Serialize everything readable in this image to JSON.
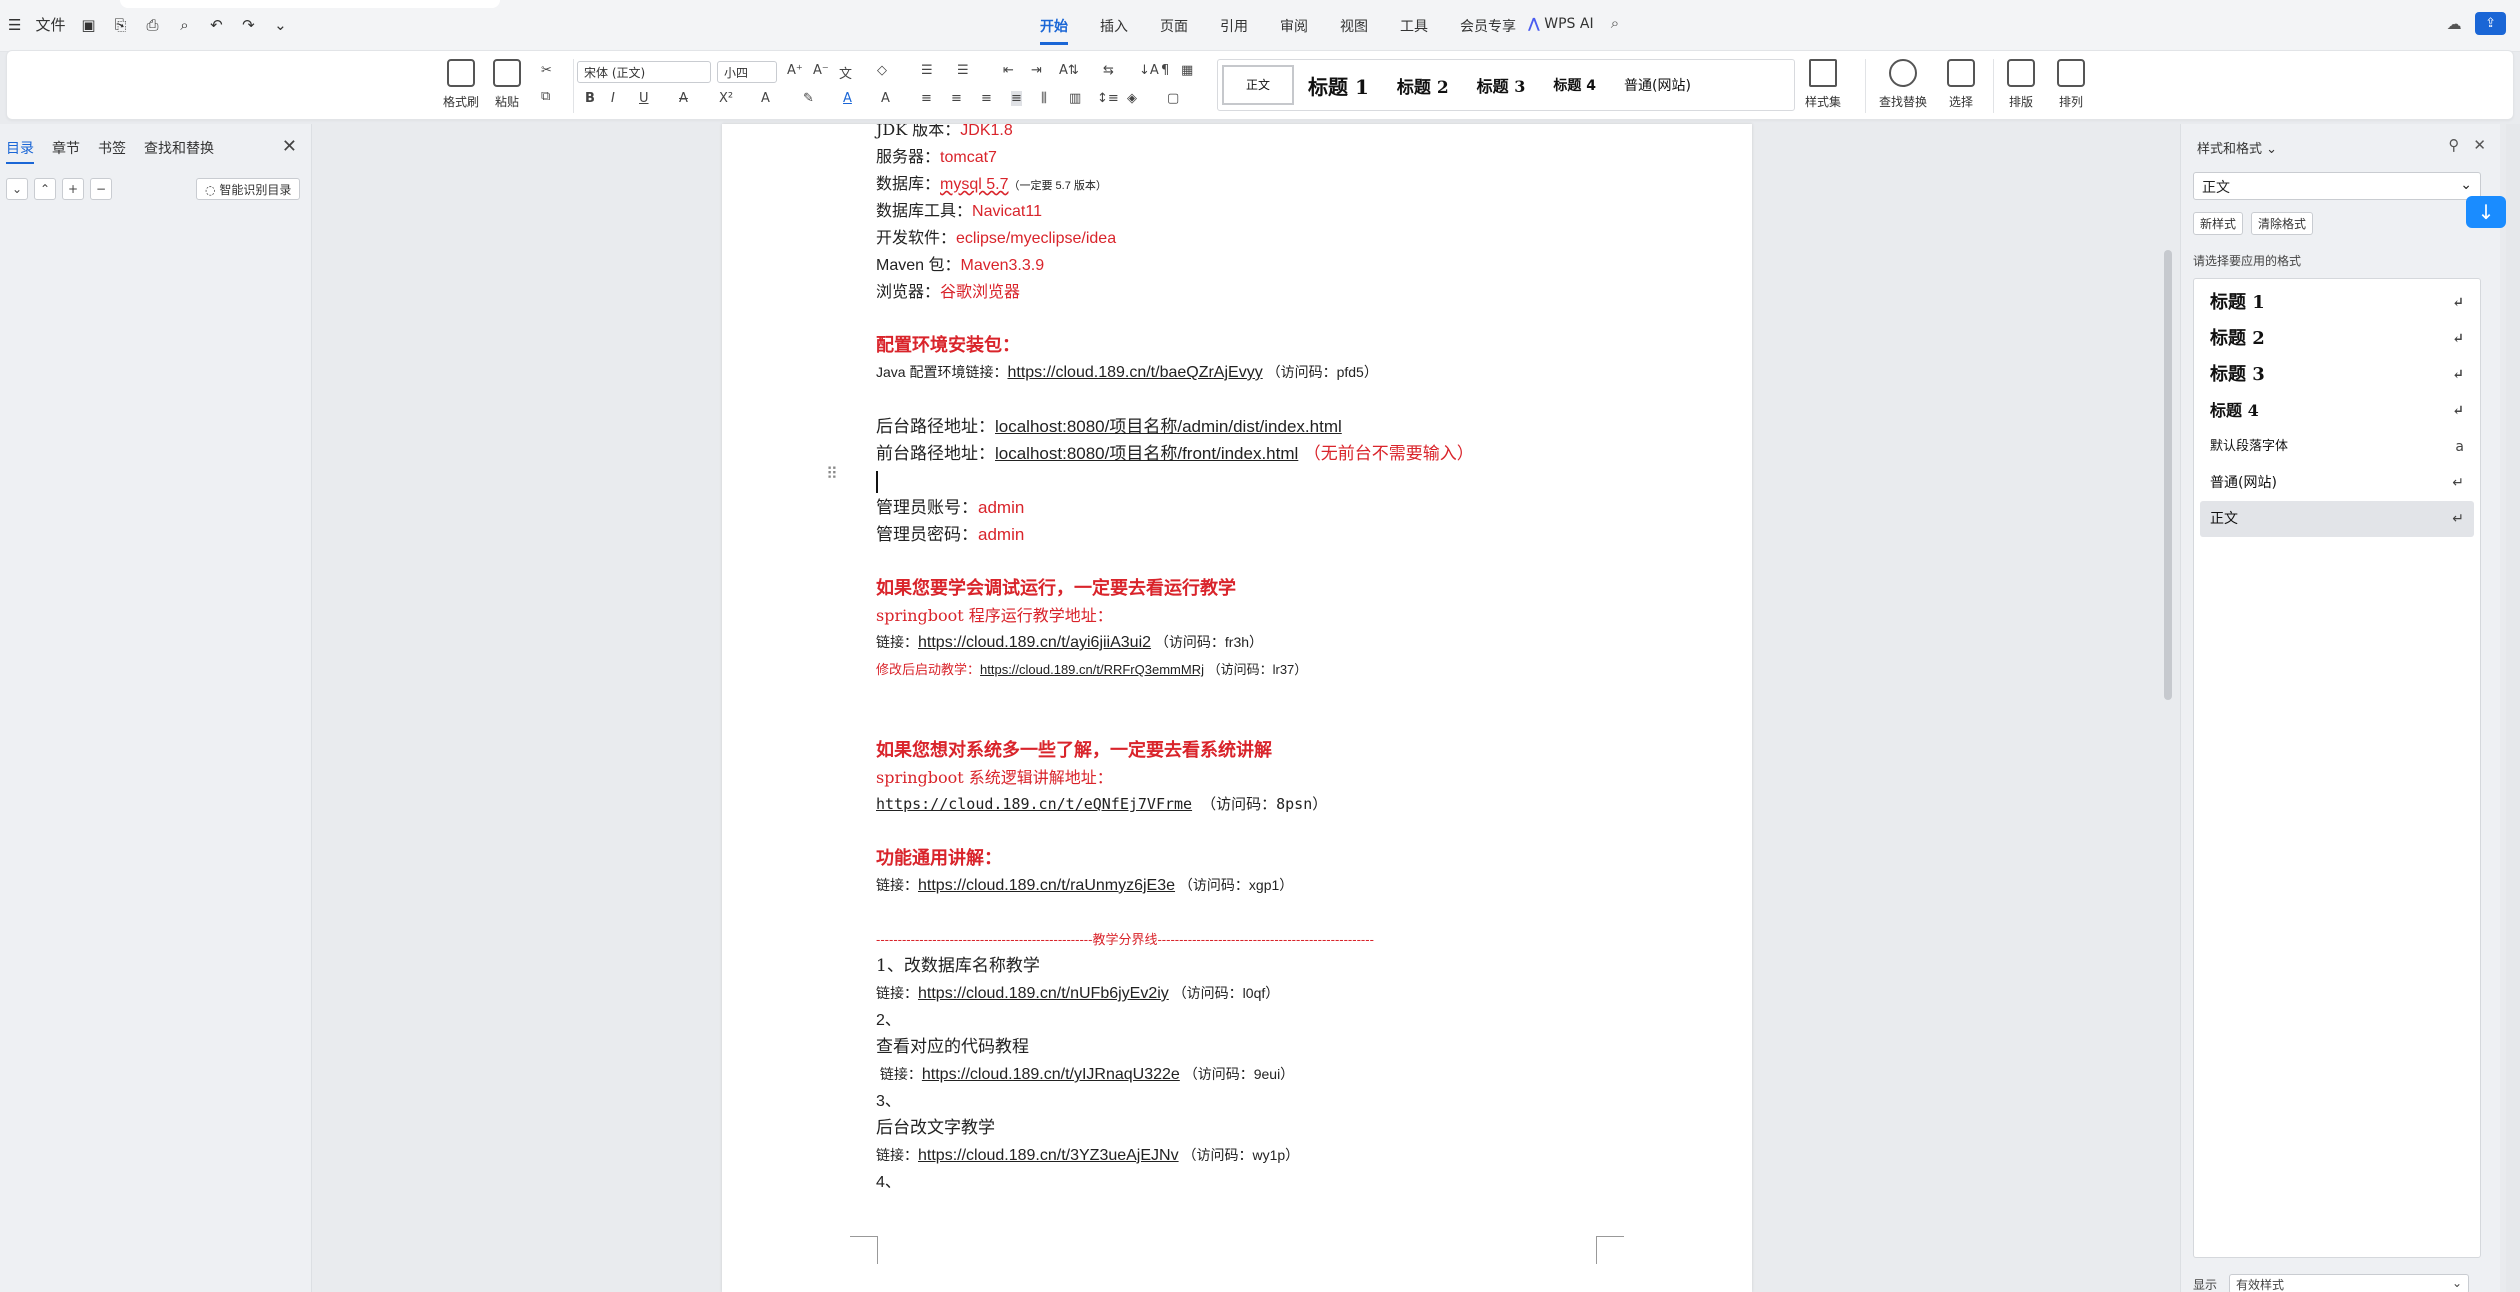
{
  "menubar": {
    "file": "文件",
    "tabs": [
      "开始",
      "插入",
      "页面",
      "引用",
      "审阅",
      "视图",
      "工具",
      "会员专享"
    ],
    "wps_ai": "WPS AI"
  },
  "ribbon": {
    "format_painter": "格式刷",
    "paste": "粘贴",
    "font_name": "宋体 (正文)",
    "font_size": "小四",
    "styles": [
      "正文",
      "标题 1",
      "标题 2",
      "标题 3",
      "标题 4",
      "普通(网站)"
    ],
    "style_set": "样式集",
    "find_replace": "查找替换",
    "select": "选择",
    "layout": "排版",
    "arrange": "排列"
  },
  "left_pane": {
    "tabs": [
      "目录",
      "章节",
      "书签",
      "查找和替换"
    ],
    "smart_toc": "智能识别目录"
  },
  "doc": {
    "jdk_label": "JDK 版本：",
    "jdk_value": "JDK1.8",
    "server_label": "服务器：",
    "server_value": "tomcat7",
    "db_label": "数据库：",
    "db_value": "mysql 5.7",
    "db_note": "（一定要 5.7 版本）",
    "dbtool_label": "数据库工具：",
    "dbtool_value": "Navicat11",
    "ide_label": "开发软件：",
    "ide_value": "eclipse/myeclipse/idea",
    "maven_label": "Maven 包：",
    "maven_value": "Maven3.3.9",
    "browser_label": "浏览器：",
    "browser_value": "谷歌浏览器",
    "env_heading": "配置环境安装包：",
    "java_env": "Java 配置环境链接：",
    "java_env_link": "https://cloud.189.cn/t/baeQZrAjEvyy",
    "java_env_code": "（访问码：pfd5）",
    "backend_label": "后台路径地址：",
    "backend_value": "localhost:8080/项目名称/admin/dist/index.html",
    "frontend_label": "前台路径地址：",
    "frontend_value": "localhost:8080/项目名称/front/index.html",
    "frontend_note": "（无前台不需要输入）",
    "admin_user_label": "管理员账号：",
    "admin_user": "admin",
    "admin_pwd_label": "管理员密码：",
    "admin_pwd": "admin",
    "run_heading": "如果您要学会调试运行，一定要去看运行教学",
    "run_sub": "springboot 程序运行教学地址：",
    "run_link_label": "链接：",
    "run_link": "https://cloud.189.cn/t/ayi6jiiA3ui2",
    "run_code": "（访问码：fr3h）",
    "modify_label": "修改后启动教学：",
    "modify_link": "https://cloud.189.cn/t/RRFrQ3emmMRj",
    "modify_code": "（访问码：lr37）",
    "sys_heading": "如果您想对系统多一些了解，一定要去看系统讲解",
    "sys_sub": "springboot 系统逻辑讲解地址：",
    "sys_link": "https://cloud.189.cn/t/eQNfEj7VFrme",
    "sys_code": "（访问码：8psn）",
    "func_heading": "功能通用讲解：",
    "func_link_label": "链接：",
    "func_link": "https://cloud.189.cn/t/raUnmyz6jE3e",
    "func_code": "（访问码：xgp1）",
    "divider": "--------------------------------------------------教学分界线--------------------------------------------------",
    "item1": "1、改数据库名称教学",
    "item1_link_label": "链接：",
    "item1_link": "https://cloud.189.cn/t/nUFb6jyEv2iy",
    "item1_code": "（访问码：l0qf）",
    "item2": "2、",
    "item2_title": "查看对应的代码教程",
    "item2_link_label": "链接：",
    "item2_link": "https://cloud.189.cn/t/yIJRnaqU322e",
    "item2_code": "（访问码：9eui）",
    "item3": "3、",
    "item3_title": "后台改文字教学",
    "item3_link_label": "链接：",
    "item3_link": "https://cloud.189.cn/t/3YZ3ueAjEJNv",
    "item3_code": "（访问码：wy1p）",
    "item4": "4、"
  },
  "right_pane": {
    "title": "样式和格式",
    "current_style": "正文",
    "new_style": "新样式",
    "clear_format": "清除格式",
    "hint": "请选择要应用的格式",
    "styles": [
      "标题 1",
      "标题 2",
      "标题 3",
      "标题 4",
      "默认段落字体",
      "普通(网站)",
      "正文"
    ],
    "show_label": "显示",
    "show_value": "有效样式"
  },
  "colors": {
    "accent": "#1a66d6",
    "red_text": "#d9242b"
  }
}
